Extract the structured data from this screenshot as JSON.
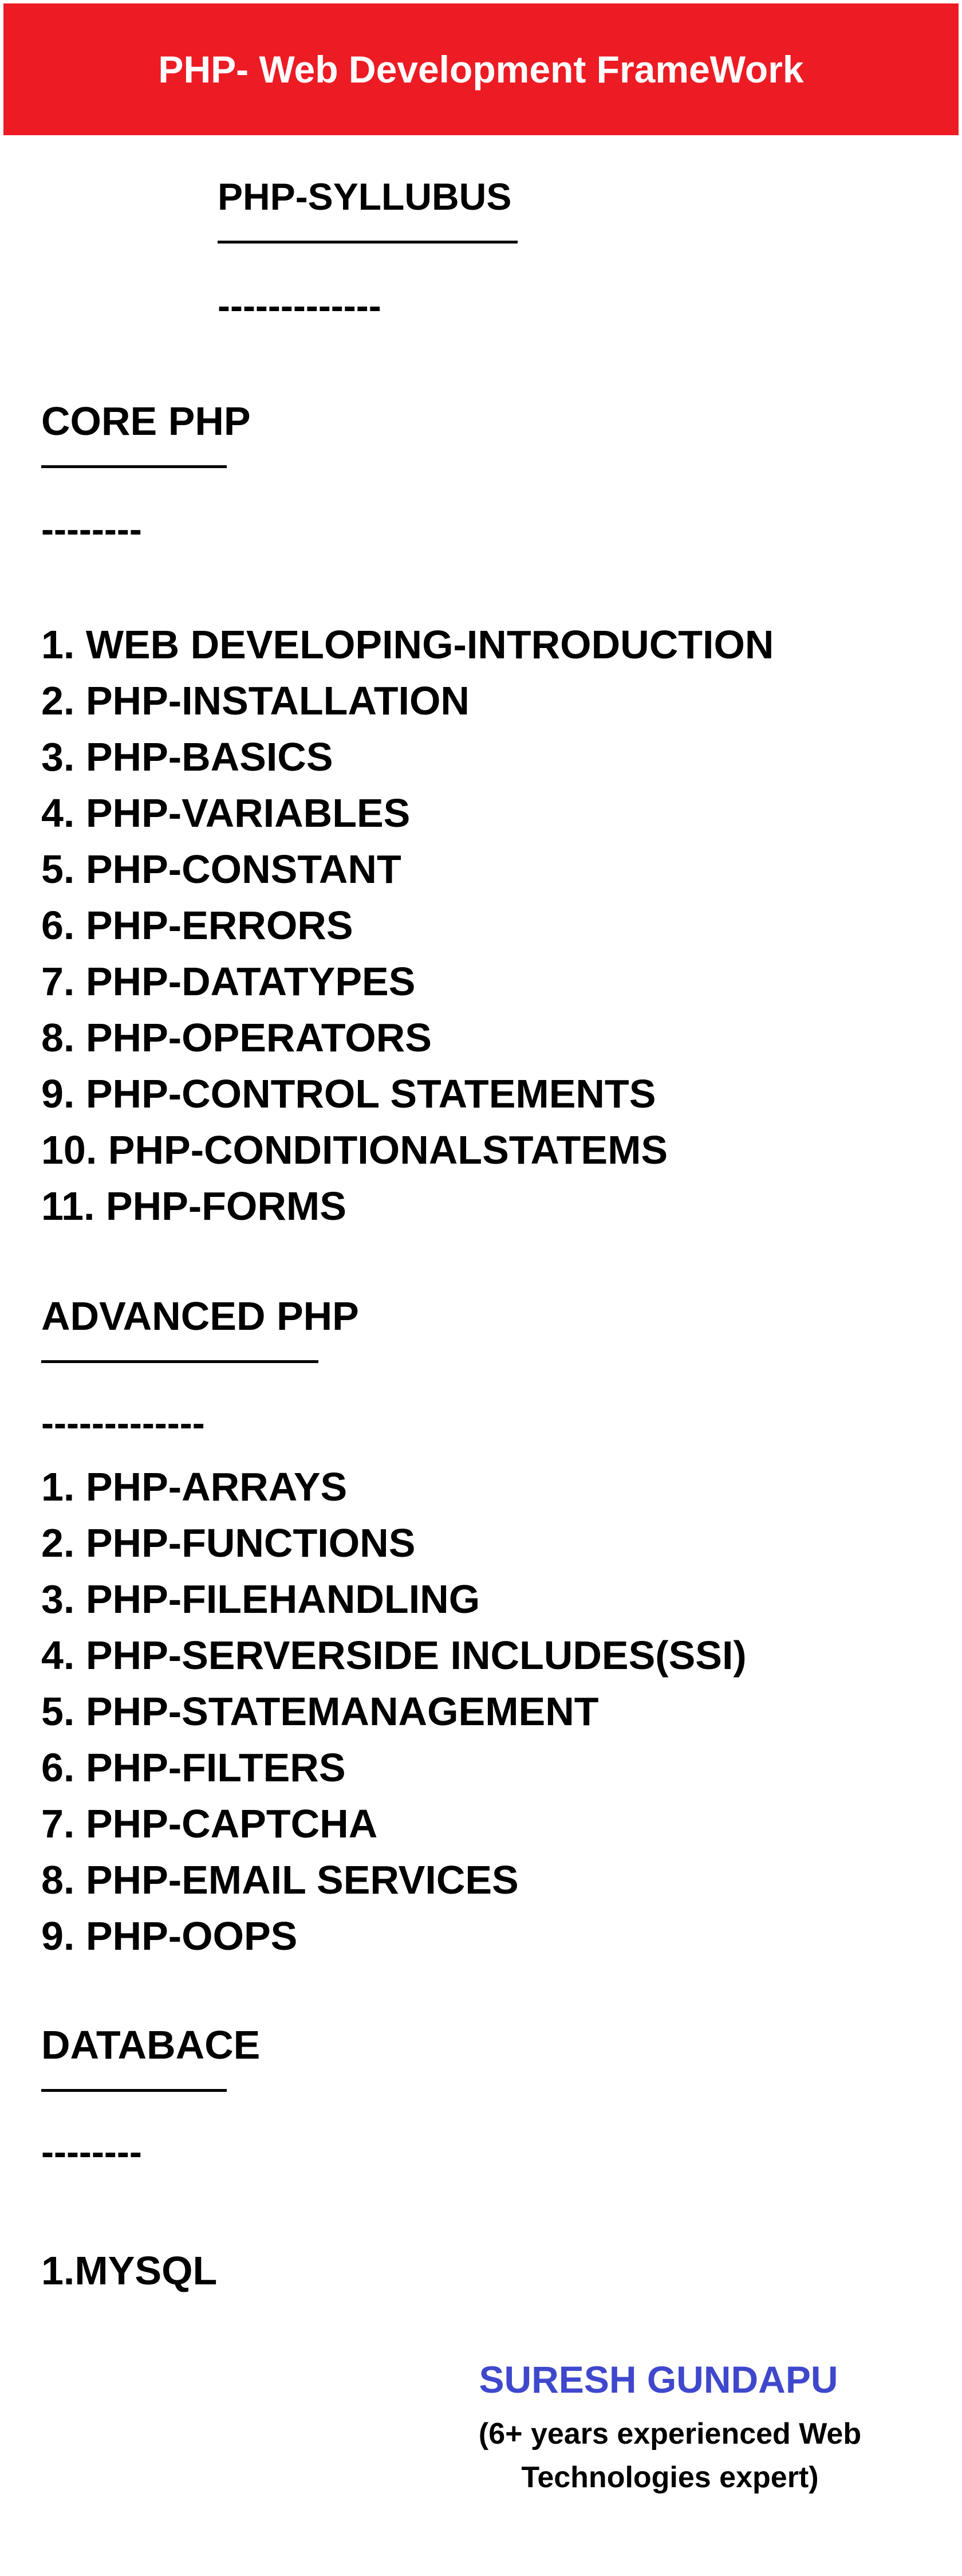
{
  "header": {
    "title": "PHP- Web Development FrameWork",
    "background_color": "#ed1c24"
  },
  "syllabus": {
    "title": "PHP-SYLLUBUS",
    "dashes": "-------------"
  },
  "core": {
    "heading": "CORE PHP",
    "dashes": "--------",
    "items": [
      "1. WEB DEVELOPING-INTRODUCTION",
      "2. PHP-INSTALLATION",
      "3. PHP-BASICS",
      "4. PHP-VARIABLES",
      "5. PHP-CONSTANT",
      "6. PHP-ERRORS",
      "7. PHP-DATATYPES",
      "8. PHP-OPERATORS",
      "9. PHP-CONTROL STATEMENTS",
      "10. PHP-CONDITIONALSTATEMS",
      "11. PHP-FORMS"
    ]
  },
  "advanced": {
    "heading": "ADVANCED PHP",
    "dashes": "-------------",
    "items": [
      "1. PHP-ARRAYS",
      "2. PHP-FUNCTIONS",
      "3. PHP-FILEHANDLING",
      "4. PHP-SERVERSIDE INCLUDES(SSI)",
      "5. PHP-STATEMANAGEMENT",
      "6. PHP-FILTERS",
      "7. PHP-CAPTCHA",
      "8. PHP-EMAIL SERVICES",
      "9. PHP-OOPS"
    ]
  },
  "database": {
    "heading": "DATABACE",
    "dashes": "--------",
    "items": [
      "1.MYSQL"
    ]
  },
  "author": {
    "name": "SURESH GUNDAPU",
    "desc_line1": "(6+ years experienced Web",
    "desc_line2": "Technologies expert)",
    "name_color": "#3f48cc"
  }
}
